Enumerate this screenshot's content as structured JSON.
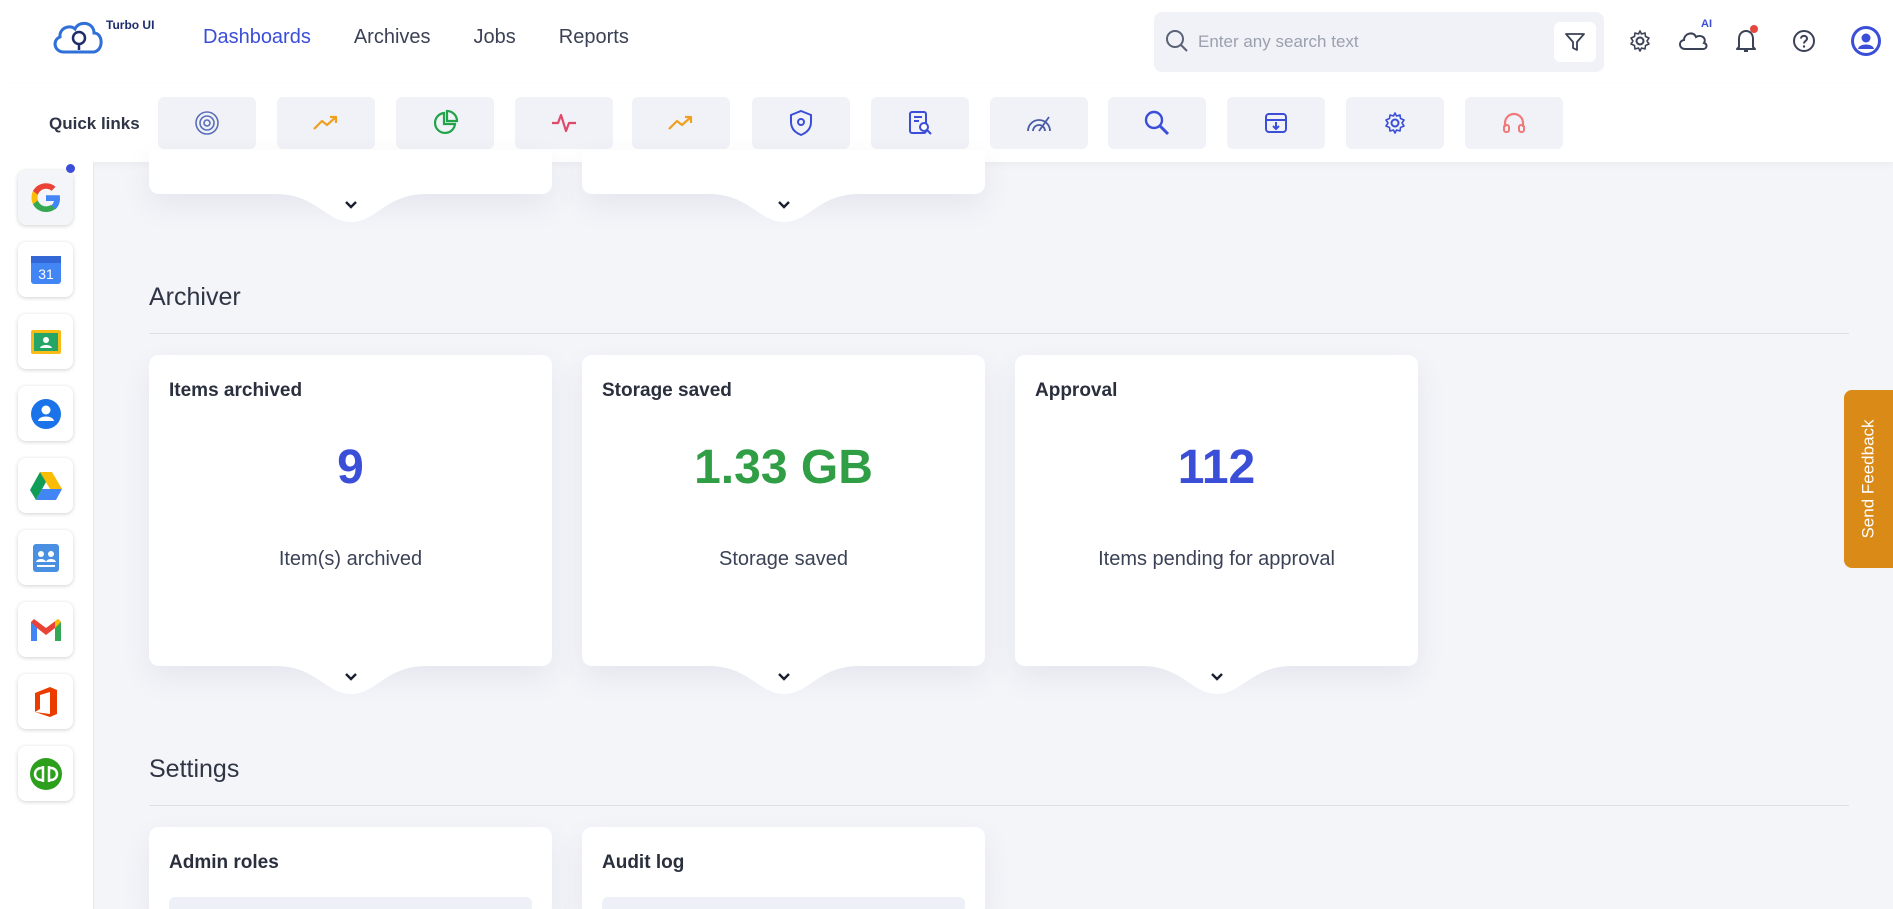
{
  "app": {
    "logo_text": "Turbo UI"
  },
  "nav": {
    "items": [
      "Dashboards",
      "Archives",
      "Jobs",
      "Reports"
    ],
    "active_index": 0
  },
  "search": {
    "placeholder": "Enter any search text",
    "value": ""
  },
  "top_icons": {
    "ai_badge": "AI"
  },
  "quick_links": {
    "label": "Quick links",
    "items": [
      {
        "icon": "fingerprint-radar-icon",
        "color": "#5b6fb8"
      },
      {
        "icon": "trend-up-icon",
        "color": "#f0a020"
      },
      {
        "icon": "pie-chart-icon",
        "color": "#21a34a"
      },
      {
        "icon": "activity-pulse-icon",
        "color": "#e04a6a"
      },
      {
        "icon": "trend-up-icon",
        "color": "#f0a020"
      },
      {
        "icon": "shield-icon",
        "color": "#3b4ed8"
      },
      {
        "icon": "document-search-icon",
        "color": "#3b4ed8"
      },
      {
        "icon": "radar-scan-icon",
        "color": "#4a5ba8"
      },
      {
        "icon": "magnifier-icon",
        "color": "#3b4ed8"
      },
      {
        "icon": "archive-box-icon",
        "color": "#3b4ed8"
      },
      {
        "icon": "gear-icon",
        "color": "#3b4ed8"
      },
      {
        "icon": "headset-icon",
        "color": "#f07a7a"
      }
    ]
  },
  "sidebar_apps": [
    "google-icon",
    "google-calendar-icon",
    "google-classroom-icon",
    "contacts-icon",
    "google-drive-icon",
    "directory-icon",
    "gmail-icon",
    "office-icon",
    "quickbooks-icon"
  ],
  "calendar_day": "31",
  "sections": {
    "archiver": {
      "title": "Archiver",
      "cards": [
        {
          "title": "Items archived",
          "value": "9",
          "subtitle": "Item(s) archived",
          "color": "#3b4ed8"
        },
        {
          "title": "Storage saved",
          "value": "1.33 GB",
          "subtitle": "Storage saved",
          "color": "#2f9e44"
        },
        {
          "title": "Approval",
          "value": "112",
          "subtitle": "Items pending for approval",
          "color": "#3b4ed8"
        }
      ]
    },
    "settings": {
      "title": "Settings",
      "cards": [
        {
          "title": "Admin roles"
        },
        {
          "title": "Audit log"
        }
      ]
    }
  },
  "feedback": {
    "label": "Send Feedback"
  }
}
